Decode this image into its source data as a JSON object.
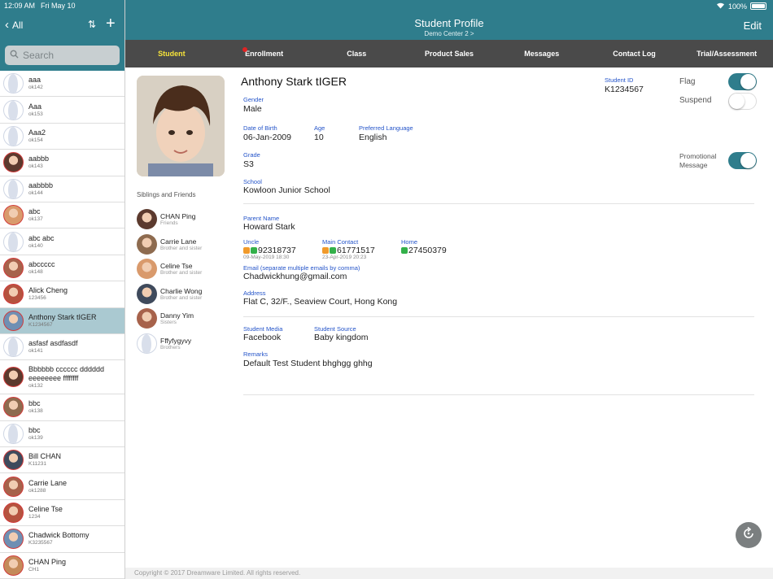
{
  "status": {
    "time": "12:09 AM",
    "date": "Fri May 10",
    "battery": "100%"
  },
  "sidebar": {
    "back_label": "All",
    "search_placeholder": "Search",
    "items": [
      {
        "name": "aaa",
        "id": "ok142",
        "avatar": "generic"
      },
      {
        "name": "Aaa",
        "id": "ok153",
        "avatar": "generic"
      },
      {
        "name": "Aaa2",
        "id": "ok154",
        "avatar": "generic"
      },
      {
        "name": "aabbb",
        "id": "ok143",
        "avatar": "photo"
      },
      {
        "name": "aabbbb",
        "id": "ok144",
        "avatar": "generic"
      },
      {
        "name": "abc",
        "id": "ok137",
        "avatar": "photo"
      },
      {
        "name": "abc abc",
        "id": "ok140",
        "avatar": "generic"
      },
      {
        "name": "abccccc",
        "id": "ok148",
        "avatar": "photo"
      },
      {
        "name": "Alick Cheng",
        "id": "123456",
        "avatar": "photo"
      },
      {
        "name": "Anthony Stark tIGER",
        "id": "K1234567",
        "avatar": "photo",
        "selected": true
      },
      {
        "name": "asfasf asdfasdf",
        "id": "ok141",
        "avatar": "generic"
      },
      {
        "name": "Bbbbbb cccccc dddddd eeeeeeee ffffffff",
        "id": "ok132",
        "avatar": "photo"
      },
      {
        "name": "bbc",
        "id": "ok138",
        "avatar": "photo"
      },
      {
        "name": "bbc",
        "id": "ok139",
        "avatar": "generic"
      },
      {
        "name": "Bill CHAN",
        "id": "K11231",
        "avatar": "photo"
      },
      {
        "name": "Carrie Lane",
        "id": "ok1288",
        "avatar": "photo"
      },
      {
        "name": "Celine Tse",
        "id": "1234",
        "avatar": "photo"
      },
      {
        "name": "Chadwick Bottomy",
        "id": "K3235567",
        "avatar": "photo"
      },
      {
        "name": "CHAN Ping",
        "id": "CH1",
        "avatar": "photo"
      }
    ]
  },
  "header": {
    "title": "Student Profile",
    "subtitle": "Demo Center 2 >",
    "edit_label": "Edit"
  },
  "tabs": [
    "Student",
    "Enrollment",
    "Class",
    "Product Sales",
    "Messages",
    "Contact Log",
    "Trial/Assessment"
  ],
  "active_tab": "Student",
  "siblings": {
    "title": "Siblings and Friends",
    "items": [
      {
        "name": "CHAN Ping",
        "relation": "Friends",
        "avatar": "photo"
      },
      {
        "name": "Carrie Lane",
        "relation": "Brother and sister",
        "avatar": "photo"
      },
      {
        "name": "Celine Tse",
        "relation": "Brother and sister",
        "avatar": "photo"
      },
      {
        "name": "Charlie Wong",
        "relation": "Brother and sister",
        "avatar": "photo"
      },
      {
        "name": "Danny Yim",
        "relation": "Sisters",
        "avatar": "photo"
      },
      {
        "name": "Fffyfygyvy",
        "relation": "Brothers",
        "avatar": "generic"
      }
    ]
  },
  "student": {
    "full_name": "Anthony Stark tIGER",
    "student_id_label": "Student ID",
    "student_id": "K1234567",
    "gender_label": "Gender",
    "gender": "Male",
    "dob_label": "Date of Birth",
    "dob": "06-Jan-2009",
    "age_label": "Age",
    "age": "10",
    "lang_label": "Preferred Language",
    "lang": "English",
    "grade_label": "Grade",
    "grade": "S3",
    "school_label": "School",
    "school": "Kowloon Junior School",
    "flag_label": "Flag",
    "flag": true,
    "suspend_label": "Suspend",
    "suspend": false,
    "promo_label": "Promotional Message",
    "promo": true
  },
  "parent": {
    "name_label": "Parent Name",
    "name": "Howard Stark",
    "uncle_label": "Uncle",
    "uncle_phone": "92318737",
    "uncle_ts": "09-May-2019 18:30",
    "main_label": "Main Contact",
    "main_phone": "61771517",
    "main_ts": "23-Apr-2019 20:23",
    "home_label": "Home",
    "home_phone": "27450379",
    "email_label": "Email (separate multiple emails by comma)",
    "email": "Chadwickhung@gmail.com",
    "address_label": "Address",
    "address": "Flat C, 32/F., Seaview Court, Hong Kong"
  },
  "misc": {
    "media_label": "Student Media",
    "media": "Facebook",
    "source_label": "Student Source",
    "source": "Baby kingdom",
    "remarks_label": "Remarks",
    "remarks": "Default Test Student bhghgg ghhg"
  },
  "footer": "Copyright © 2017 Dreamware Limited. All rights reserved.",
  "colors": {
    "teal": "#2f7d8c",
    "tabbar": "#4a4a4a",
    "active_tab": "#f7e43a",
    "label_blue": "#2454c9"
  }
}
